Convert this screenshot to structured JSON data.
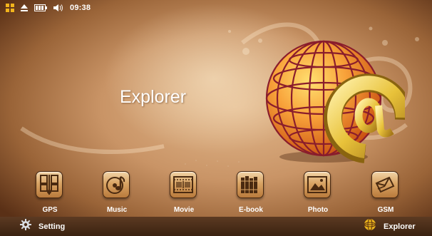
{
  "status_bar": {
    "time": "09:38",
    "icons": [
      "grid-icon",
      "eject-icon",
      "battery-icon",
      "volume-icon"
    ]
  },
  "hero": {
    "title": "Explorer"
  },
  "dock": {
    "apps": [
      {
        "label": "GPS",
        "icon": "gps-icon"
      },
      {
        "label": "Music",
        "icon": "music-icon"
      },
      {
        "label": "Movie",
        "icon": "movie-icon"
      },
      {
        "label": "E-book",
        "icon": "ebook-icon"
      },
      {
        "label": "Photo",
        "icon": "photo-icon"
      },
      {
        "label": "GSM",
        "icon": "gsm-icon"
      }
    ]
  },
  "bottom_bar": {
    "setting_label": "Setting",
    "current_label": "Explorer"
  },
  "colors": {
    "accent_orange": "#f08a1c",
    "background_tan": "#c99466",
    "bar_brown": "#3a2210",
    "globe_lines": "#8a1d2c",
    "at_gold": "#e8c23a"
  }
}
